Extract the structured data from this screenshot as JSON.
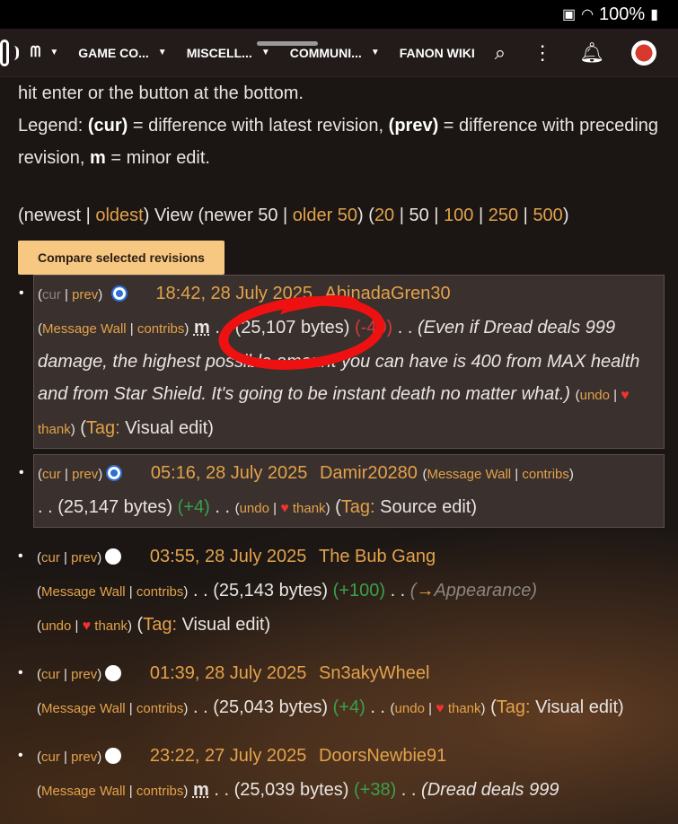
{
  "status": {
    "battery": "100%"
  },
  "nav": {
    "items": [
      {
        "label": "GAME CO..."
      },
      {
        "label": "MISCELL..."
      },
      {
        "label": "COMMUNI..."
      }
    ],
    "wiki_link": "FANON WIKI"
  },
  "intro": {
    "line1": "hit enter or the button at the bottom.",
    "legend_prefix": "Legend: ",
    "cur": "(cur)",
    "cur_desc": " = difference with latest revision, ",
    "prev": "(prev)",
    "prev_desc": " = difference with preceding revision, ",
    "m": "m",
    "m_desc": " = minor edit."
  },
  "pager": {
    "newest": "newest",
    "oldest": "oldest",
    "view": "View",
    "newer": "newer 50",
    "older": "older 50",
    "sizes": [
      "20",
      "50",
      "100",
      "250",
      "500"
    ]
  },
  "compare_button": "Compare selected revisions",
  "revisions": [
    {
      "time": "18:42, 28 July 2025",
      "user": "AbinadaGren30",
      "minor": "m",
      "bytes": "(25,107 bytes)",
      "delta": "(-40)",
      "summary": "(Even if Dread deals 999 damage, the highest possible amount you can have is 400 from MAX health and from Star Shield. It's going to be instant death no matter what.)",
      "tag": "Visual edit"
    },
    {
      "time": "05:16, 28 July 2025",
      "user": "Damir20280",
      "bytes": "(25,147 bytes)",
      "delta": "(+4)",
      "tag": "Source edit"
    },
    {
      "time": "03:55, 28 July 2025",
      "user": "The Bub Gang",
      "bytes": "(25,143 bytes)",
      "delta": "(+100)",
      "summary_arrow": "→",
      "summary": "Appearance",
      "tag": "Visual edit"
    },
    {
      "time": "01:39, 28 July 2025",
      "user": "Sn3akyWheel",
      "bytes": "(25,043 bytes)",
      "delta": "(+4)",
      "tag": "Visual edit"
    },
    {
      "time": "23:22, 27 July 2025",
      "user": "DoorsNewbie91",
      "minor": "m",
      "bytes": "(25,039 bytes)",
      "delta": "(+38)",
      "summary": "(Dread deals 999"
    }
  ],
  "labels": {
    "cur": "cur",
    "prev": "prev",
    "message_wall": "Message Wall",
    "contribs": "contribs",
    "undo": "undo",
    "thank": "thank",
    "tag": "Tag:",
    "dots": ". ."
  },
  "colors": {
    "link": "#e2a24b",
    "positive": "#3aa04a",
    "negative": "#d23b3b",
    "button_bg": "#f7c882",
    "annotation": "#ee1111"
  }
}
